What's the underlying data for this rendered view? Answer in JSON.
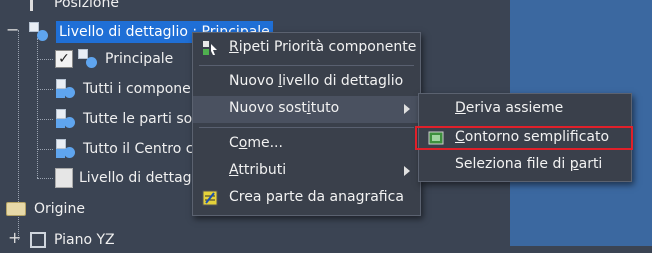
{
  "tree": {
    "top_item": "Posizione",
    "selected_item": "Livello di dettaglio : Principale",
    "children": [
      "Principale",
      "Tutti i compone",
      "Tutte le parti so",
      "Tutto il Centro c",
      "Livello di dettag"
    ],
    "origin": "Origine",
    "plane": "Piano YZ"
  },
  "context_menu": {
    "items": [
      {
        "pre": "",
        "u": "R",
        "post": "ipeti Priorità componente"
      },
      {
        "pre": "Nuovo ",
        "u": "l",
        "post": "ivello di dettaglio"
      },
      {
        "pre": "Nuovo sost",
        "u": "i",
        "post": "tuto"
      },
      {
        "pre": "C",
        "u": "o",
        "post": "me..."
      },
      {
        "pre": "",
        "u": "A",
        "post": "ttributi"
      },
      {
        "pre": "Crea parte da anagrafica",
        "u": "",
        "post": ""
      }
    ]
  },
  "submenu": {
    "items": [
      {
        "pre": "",
        "u": "D",
        "post": "eriva assieme"
      },
      {
        "pre": "",
        "u": "C",
        "post": "ontorno semplificato"
      },
      {
        "pre": "Seleziona file di ",
        "u": "p",
        "post": "arti"
      }
    ]
  },
  "colors": {
    "background": "#3b4453",
    "selection": "#1f6fd6",
    "menu_bg": "#3a404b",
    "highlight_box": "#e0202a"
  }
}
